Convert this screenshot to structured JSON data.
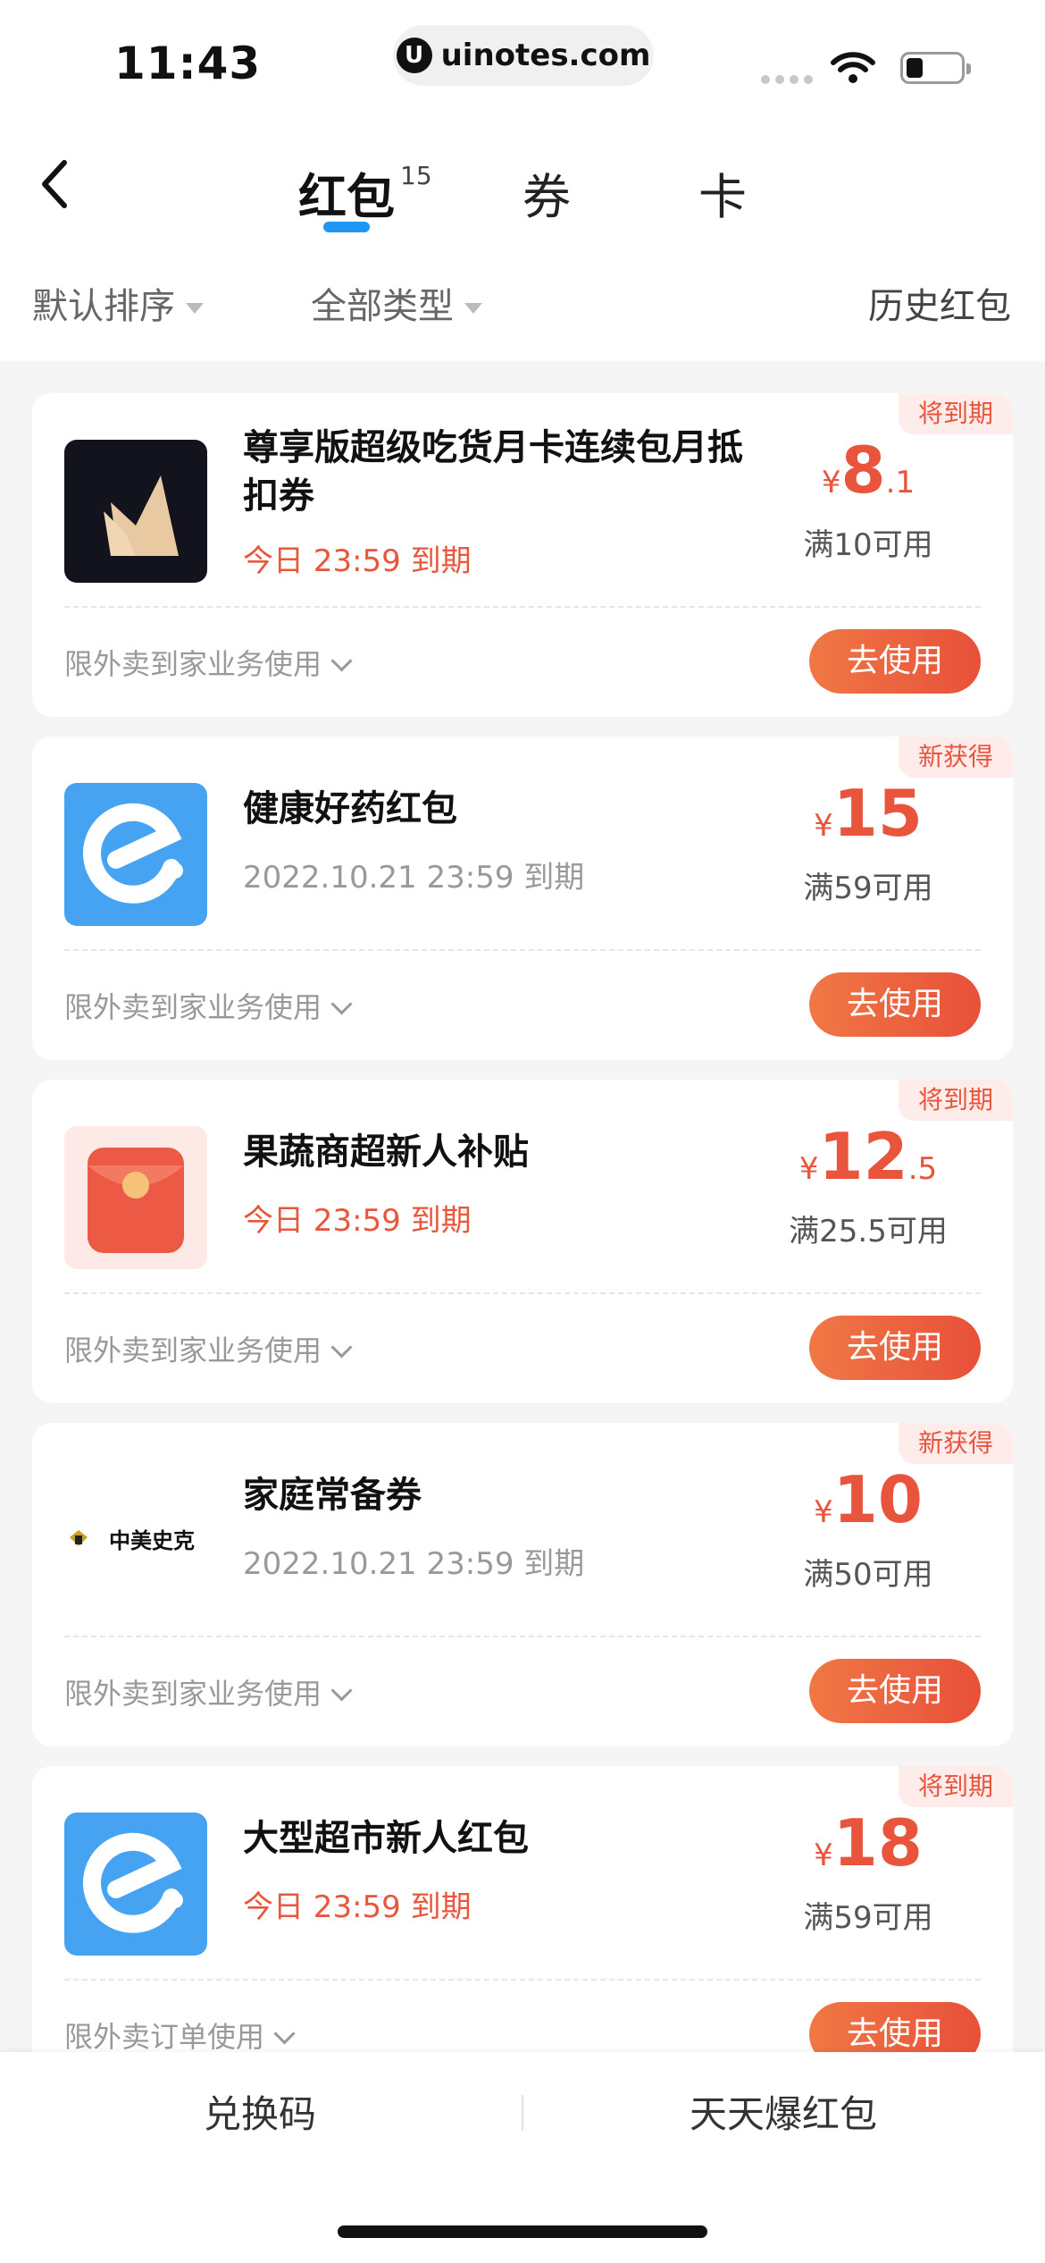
{
  "status_bar": {
    "time": "11:43",
    "url": "uinotes.com",
    "url_logo": "U"
  },
  "nav": {
    "tabs": [
      {
        "label": "红包",
        "badge": "15",
        "active": true
      },
      {
        "label": "券"
      },
      {
        "label": "卡"
      }
    ],
    "accent_color": "#2196f3"
  },
  "filters": {
    "sort": "默认排序",
    "type": "全部类型",
    "history": "历史红包"
  },
  "cards": [
    {
      "title": "尊享版超级吃货月卡连续包月抵扣券",
      "expiry": "今日 23:59 到期",
      "urgent": true,
      "currency": "¥",
      "amount_int": "8",
      "amount_dec": ".1",
      "min_use": "满10可用",
      "tag": "将到期",
      "scope": "限外卖到家业务使用",
      "button": "去使用",
      "icon": "crown-icon"
    },
    {
      "title": "健康好药红包",
      "expiry": "2022.10.21 23:59 到期",
      "urgent": false,
      "currency": "¥",
      "amount_int": "15",
      "amount_dec": "",
      "min_use": "满59可用",
      "tag": "新获得",
      "scope": "限外卖到家业务使用",
      "button": "去使用",
      "icon": "eleme-logo-icon"
    },
    {
      "title": "果蔬商超新人补贴",
      "expiry": "今日 23:59 到期",
      "urgent": true,
      "currency": "¥",
      "amount_int": "12",
      "amount_dec": ".5",
      "min_use": "满25.5可用",
      "tag": "将到期",
      "scope": "限外卖到家业务使用",
      "button": "去使用",
      "icon": "red-envelope-icon"
    },
    {
      "title": "家庭常备券",
      "expiry": "2022.10.21 23:59 到期",
      "urgent": false,
      "currency": "¥",
      "amount_int": "10",
      "amount_dec": "",
      "min_use": "满50可用",
      "tag": "新获得",
      "scope": "限外卖到家业务使用",
      "button": "去使用",
      "icon": "brand-logo-icon",
      "brand_text": "中美史克"
    },
    {
      "title": "大型超市新人红包",
      "expiry": "今日 23:59 到期",
      "urgent": true,
      "currency": "¥",
      "amount_int": "18",
      "amount_dec": "",
      "min_use": "满59可用",
      "tag": "将到期",
      "scope": "限外卖订单使用",
      "button": "去使用",
      "icon": "eleme-logo-icon"
    }
  ],
  "bottom_bar": {
    "left": "兑换码",
    "right": "天天爆红包"
  },
  "colors": {
    "price": "#e8553c",
    "button": "#ec643f",
    "tag_bg": "#fdecea"
  }
}
